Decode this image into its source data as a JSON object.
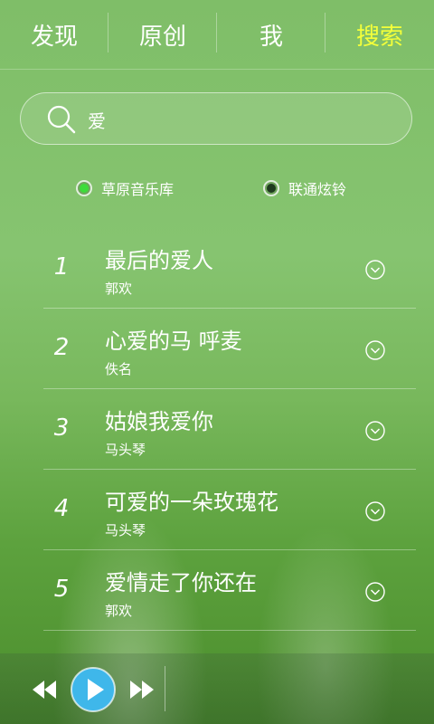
{
  "tabs": [
    {
      "label": "发现",
      "active": false
    },
    {
      "label": "原创",
      "active": false
    },
    {
      "label": "我",
      "active": false
    },
    {
      "label": "搜索",
      "active": true
    }
  ],
  "search": {
    "value": "爱",
    "icon": "search-icon"
  },
  "sources": [
    {
      "label": "草原音乐库",
      "selected": true,
      "color": "#3ddc3a"
    },
    {
      "label": "联通炫铃",
      "selected": false,
      "color": "#1f3a1f"
    }
  ],
  "songs": [
    {
      "rank": "1",
      "title": "最后的爱人",
      "artist": "郭欢"
    },
    {
      "rank": "2",
      "title": "心爱的马 呼麦",
      "artist": "佚名"
    },
    {
      "rank": "3",
      "title": "姑娘我爱你",
      "artist": "马头琴"
    },
    {
      "rank": "4",
      "title": "可爱的一朵玫瑰花",
      "artist": "马头琴"
    },
    {
      "rank": "5",
      "title": "爱情走了你还在",
      "artist": "郭欢"
    }
  ],
  "colors": {
    "active_tab": "#f3ff3a",
    "play_button": "#3fb7ea"
  },
  "player": {
    "controls": [
      "rewind-icon",
      "play-icon",
      "fast-forward-icon"
    ]
  }
}
